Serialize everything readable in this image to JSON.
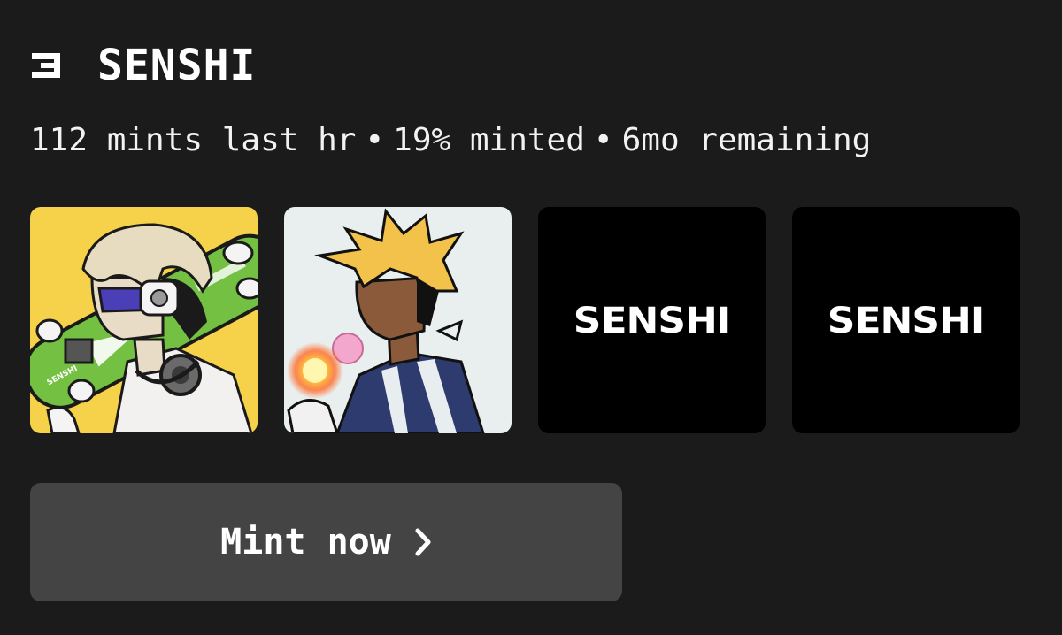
{
  "collection": {
    "title": "SENSHI",
    "logo_icon": "senshi-logo-icon"
  },
  "stats": {
    "mints": "112 mints last hr",
    "separator": "•",
    "minted": "19% minted",
    "remaining": "6mo remaining"
  },
  "thumbnails": [
    {
      "kind": "artwork",
      "subject": "character-with-skateboard",
      "background": "#f6d24a",
      "board_text": "SENSHI"
    },
    {
      "kind": "artwork",
      "subject": "character-with-bubblegum",
      "background": "#e9efee"
    },
    {
      "kind": "placeholder",
      "brand": "SENSHI",
      "background": "#000000"
    },
    {
      "kind": "placeholder",
      "brand": "SENSHI",
      "background": "#000000"
    }
  ],
  "mint_button": {
    "label": "Mint now",
    "icon": "chevron-right-icon"
  },
  "colors": {
    "background": "#1b1b1b",
    "button": "#444444",
    "text": "#ffffff"
  }
}
